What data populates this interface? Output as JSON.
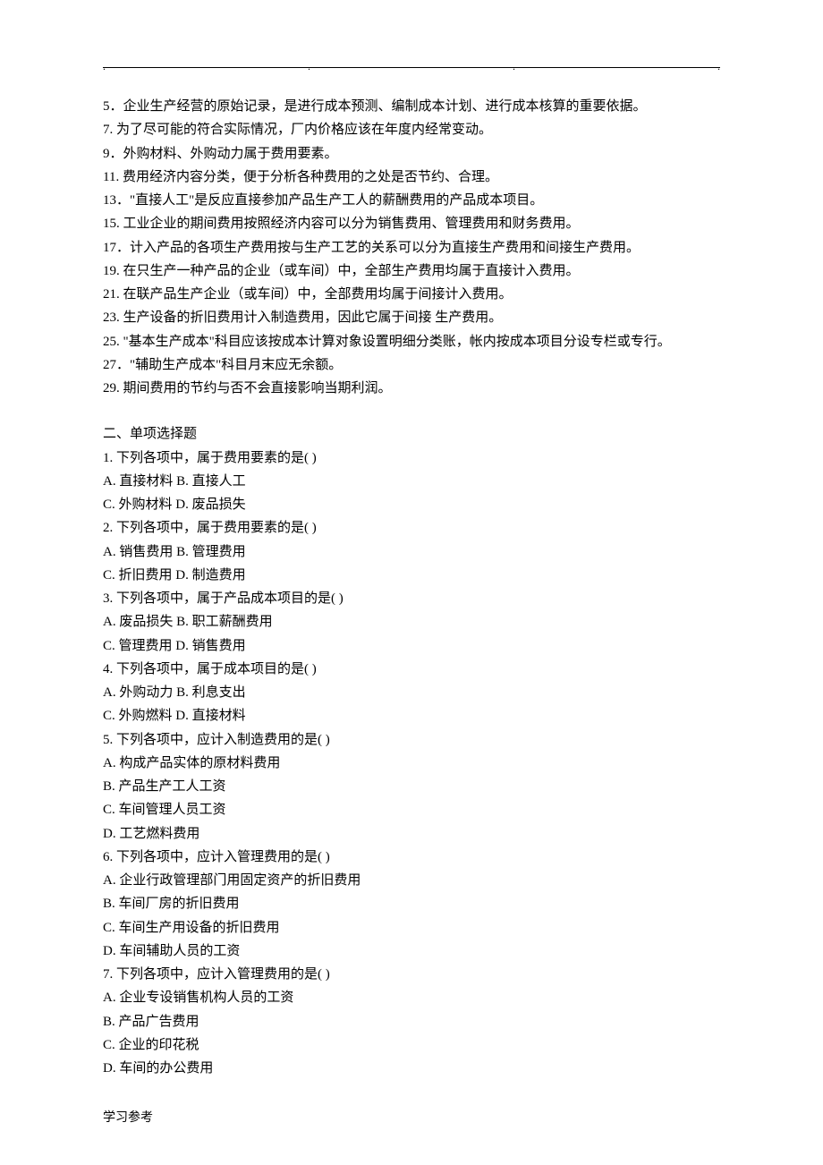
{
  "header_dots": [
    ".",
    ".",
    ".",
    "."
  ],
  "judgment": {
    "q5": "5．企业生产经营的原始记录，是进行成本预测、编制成本计划、进行成本核算的重要依据。",
    "q7": "7. 为了尽可能的符合实际情况，厂内价格应该在年度内经常变动。",
    "q9": "9．外购材料、外购动力属于费用要素。",
    "q11": "11. 费用经济内容分类，便于分析各种费用的之处是否节约、合理。",
    "q13": "13．\"直接人工\"是反应直接参加产品生产工人的薪酬费用的产品成本项目。",
    "q15": "15. 工业企业的期间费用按照经济内容可以分为销售费用、管理费用和财务费用。",
    "q17": "17．计入产品的各项生产费用按与生产工艺的关系可以分为直接生产费用和间接生产费用。",
    "q19": "19. 在只生产一种产品的企业（或车间）中，全部生产费用均属于直接计入费用。",
    "q21": "21. 在联产品生产企业（或车间）中，全部费用均属于间接计入费用。",
    "q23": "23. 生产设备的折旧费用计入制造费用，因此它属于间接 生产费用。",
    "q25": "25. \"基本生产成本\"科目应该按成本计算对象设置明细分类账，帐内按成本项目分设专栏或专行。",
    "q27": "27．\"辅助生产成本\"科目月末应无余额。",
    "q29": "29. 期间费用的节约与否不会直接影响当期利润。"
  },
  "section2_title": "二、单项选择题",
  "mcq": {
    "q1": {
      "stem": "1. 下列各项中，属于费用要素的是(   )",
      "a": "A. 直接材料   B. 直接人工",
      "c": "C. 外购材料   D. 废品损失"
    },
    "q2": {
      "stem": "2. 下列各项中，属于费用要素的是(   )",
      "a": "A. 销售费用      B. 管理费用",
      "c": "C. 折旧费用      D. 制造费用"
    },
    "q3": {
      "stem": "3. 下列各项中，属于产品成本项目的是(   )",
      "a": "A. 废品损失        B. 职工薪酬费用",
      "c": "C. 管理费用        D. 销售费用"
    },
    "q4": {
      "stem": "4. 下列各项中，属于成本项目的是(   )",
      "a": "A. 外购动力        B. 利息支出",
      "c": "C. 外购燃料        D. 直接材料"
    },
    "q5": {
      "stem": "5. 下列各项中，应计入制造费用的是(   )",
      "a": "A. 构成产品实体的原材料费用",
      "b": "B. 产品生产工人工资",
      "c": "C. 车间管理人员工资",
      "d": "D. 工艺燃料费用"
    },
    "q6": {
      "stem": "6. 下列各项中，应计入管理费用的是(   )",
      "a": "A. 企业行政管理部门用固定资产的折旧费用",
      "b": "B. 车间厂房的折旧费用",
      "c": "C. 车间生产用设备的折旧费用",
      "d": "D. 车间辅助人员的工资"
    },
    "q7": {
      "stem": "7. 下列各项中，应计入管理费用的是(   )",
      "a": "A. 企业专设销售机构人员的工资",
      "b": "B. 产品广告费用",
      "c": "C. 企业的印花税",
      "d": "D. 车间的办公费用"
    }
  },
  "footer": "学习参考"
}
